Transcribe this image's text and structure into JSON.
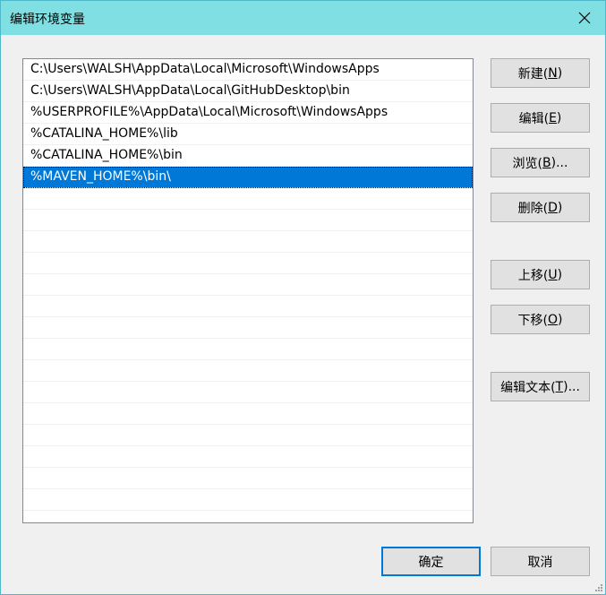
{
  "window": {
    "title": "编辑环境变量",
    "title_bar_color": "#7fdfe2"
  },
  "list": {
    "items": [
      "C:\\Users\\WALSH\\AppData\\Local\\Microsoft\\WindowsApps",
      "C:\\Users\\WALSH\\AppData\\Local\\GitHubDesktop\\bin",
      "%USERPROFILE%\\AppData\\Local\\Microsoft\\WindowsApps",
      "%CATALINA_HOME%\\lib",
      "%CATALINA_HOME%\\bin",
      "%MAVEN_HOME%\\bin\\"
    ],
    "selected_index": 5,
    "selection_color": "#0078d7"
  },
  "buttons": {
    "new": {
      "text": "新建(",
      "key": "N",
      "end": ")"
    },
    "edit": {
      "text": "编辑(",
      "key": "E",
      "end": ")"
    },
    "browse": {
      "text": "浏览(",
      "key": "B",
      "end": ")..."
    },
    "delete": {
      "text": "删除(",
      "key": "D",
      "end": ")"
    },
    "move_up": {
      "text": "上移(",
      "key": "U",
      "end": ")"
    },
    "move_down": {
      "text": "下移(",
      "key": "O",
      "end": ")"
    },
    "edit_text": {
      "text": "编辑文本(",
      "key": "T",
      "end": ")..."
    },
    "ok": "确定",
    "cancel": "取消"
  }
}
